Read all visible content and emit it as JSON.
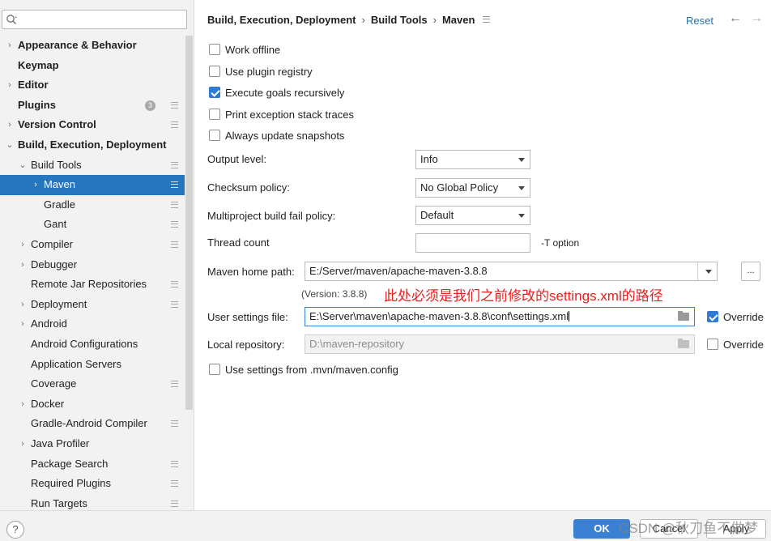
{
  "search": {
    "placeholder": ""
  },
  "tree": [
    {
      "label": "Appearance & Behavior",
      "bold": true,
      "arrow": "›",
      "indent": 0,
      "pin": false
    },
    {
      "label": "Keymap",
      "bold": true,
      "arrow": "",
      "indent": 0,
      "pin": false
    },
    {
      "label": "Editor",
      "bold": true,
      "arrow": "›",
      "indent": 0,
      "pin": false
    },
    {
      "label": "Plugins",
      "bold": true,
      "arrow": "",
      "indent": 0,
      "pin": true,
      "badge": "3"
    },
    {
      "label": "Version Control",
      "bold": true,
      "arrow": "›",
      "indent": 0,
      "pin": true
    },
    {
      "label": "Build, Execution, Deployment",
      "bold": true,
      "arrow": "⌄",
      "indent": 0,
      "pin": false
    },
    {
      "label": "Build Tools",
      "bold": false,
      "arrow": "⌄",
      "indent": 1,
      "pin": true
    },
    {
      "label": "Maven",
      "bold": false,
      "arrow": "›",
      "indent": 2,
      "pin": true,
      "selected": true
    },
    {
      "label": "Gradle",
      "bold": false,
      "arrow": "",
      "indent": 2,
      "pin": true
    },
    {
      "label": "Gant",
      "bold": false,
      "arrow": "",
      "indent": 2,
      "pin": true
    },
    {
      "label": "Compiler",
      "bold": false,
      "arrow": "›",
      "indent": 1,
      "pin": true
    },
    {
      "label": "Debugger",
      "bold": false,
      "arrow": "›",
      "indent": 1,
      "pin": false
    },
    {
      "label": "Remote Jar Repositories",
      "bold": false,
      "arrow": "",
      "indent": 1,
      "pin": true
    },
    {
      "label": "Deployment",
      "bold": false,
      "arrow": "›",
      "indent": 1,
      "pin": true
    },
    {
      "label": "Android",
      "bold": false,
      "arrow": "›",
      "indent": 1,
      "pin": false
    },
    {
      "label": "Android Configurations",
      "bold": false,
      "arrow": "",
      "indent": 1,
      "pin": false
    },
    {
      "label": "Application Servers",
      "bold": false,
      "arrow": "",
      "indent": 1,
      "pin": false
    },
    {
      "label": "Coverage",
      "bold": false,
      "arrow": "",
      "indent": 1,
      "pin": true
    },
    {
      "label": "Docker",
      "bold": false,
      "arrow": "›",
      "indent": 1,
      "pin": false
    },
    {
      "label": "Gradle-Android Compiler",
      "bold": false,
      "arrow": "",
      "indent": 1,
      "pin": true
    },
    {
      "label": "Java Profiler",
      "bold": false,
      "arrow": "›",
      "indent": 1,
      "pin": false
    },
    {
      "label": "Package Search",
      "bold": false,
      "arrow": "",
      "indent": 1,
      "pin": true
    },
    {
      "label": "Required Plugins",
      "bold": false,
      "arrow": "",
      "indent": 1,
      "pin": true
    },
    {
      "label": "Run Targets",
      "bold": false,
      "arrow": "",
      "indent": 1,
      "pin": true
    }
  ],
  "header": {
    "crumbs": [
      "Build, Execution, Deployment",
      "Build Tools",
      "Maven"
    ],
    "separator": "›",
    "reset": "Reset",
    "back": "←",
    "forward": "→"
  },
  "options": [
    {
      "label": "Work offline",
      "checked": false
    },
    {
      "label": "Use plugin registry",
      "checked": false
    },
    {
      "label": "Execute goals recursively",
      "checked": true
    },
    {
      "label": "Print exception stack traces",
      "checked": false
    },
    {
      "label": "Always update snapshots",
      "checked": false
    }
  ],
  "fields": {
    "output_level_label": "Output level:",
    "output_level_value": "Info",
    "checksum_label": "Checksum policy:",
    "checksum_value": "No Global Policy",
    "multiproject_label": "Multiproject build fail policy:",
    "multiproject_value": "Default",
    "thread_count_label": "Thread count",
    "thread_count_value": "",
    "thread_count_suffix": "-T option",
    "maven_home_label": "Maven home path:",
    "maven_home_value": "E:/Server/maven/apache-maven-3.8.8",
    "browse_label": "...",
    "version_text": "(Version: 3.8.8)",
    "annotation": "此处必须是我们之前修改的settings.xml的路径",
    "user_settings_label": "User settings file:",
    "user_settings_value": "E:\\Server\\maven\\apache-maven-3.8.8\\conf\\settings.xml",
    "user_settings_override": "Override",
    "user_settings_override_checked": true,
    "local_repo_label": "Local repository:",
    "local_repo_value": "D:\\maven-repository",
    "local_repo_override": "Override",
    "local_repo_override_checked": false,
    "mvn_config_label": "Use settings from .mvn/maven.config",
    "mvn_config_checked": false
  },
  "footer": {
    "help": "?",
    "ok": "OK",
    "cancel": "Cancel",
    "apply": "Apply",
    "watermark": "CSDN @秋刀鱼不做梦"
  },
  "colors": {
    "accent": "#2675bf",
    "annotation": "#e8201e",
    "ok_button": "#3b81d3"
  }
}
